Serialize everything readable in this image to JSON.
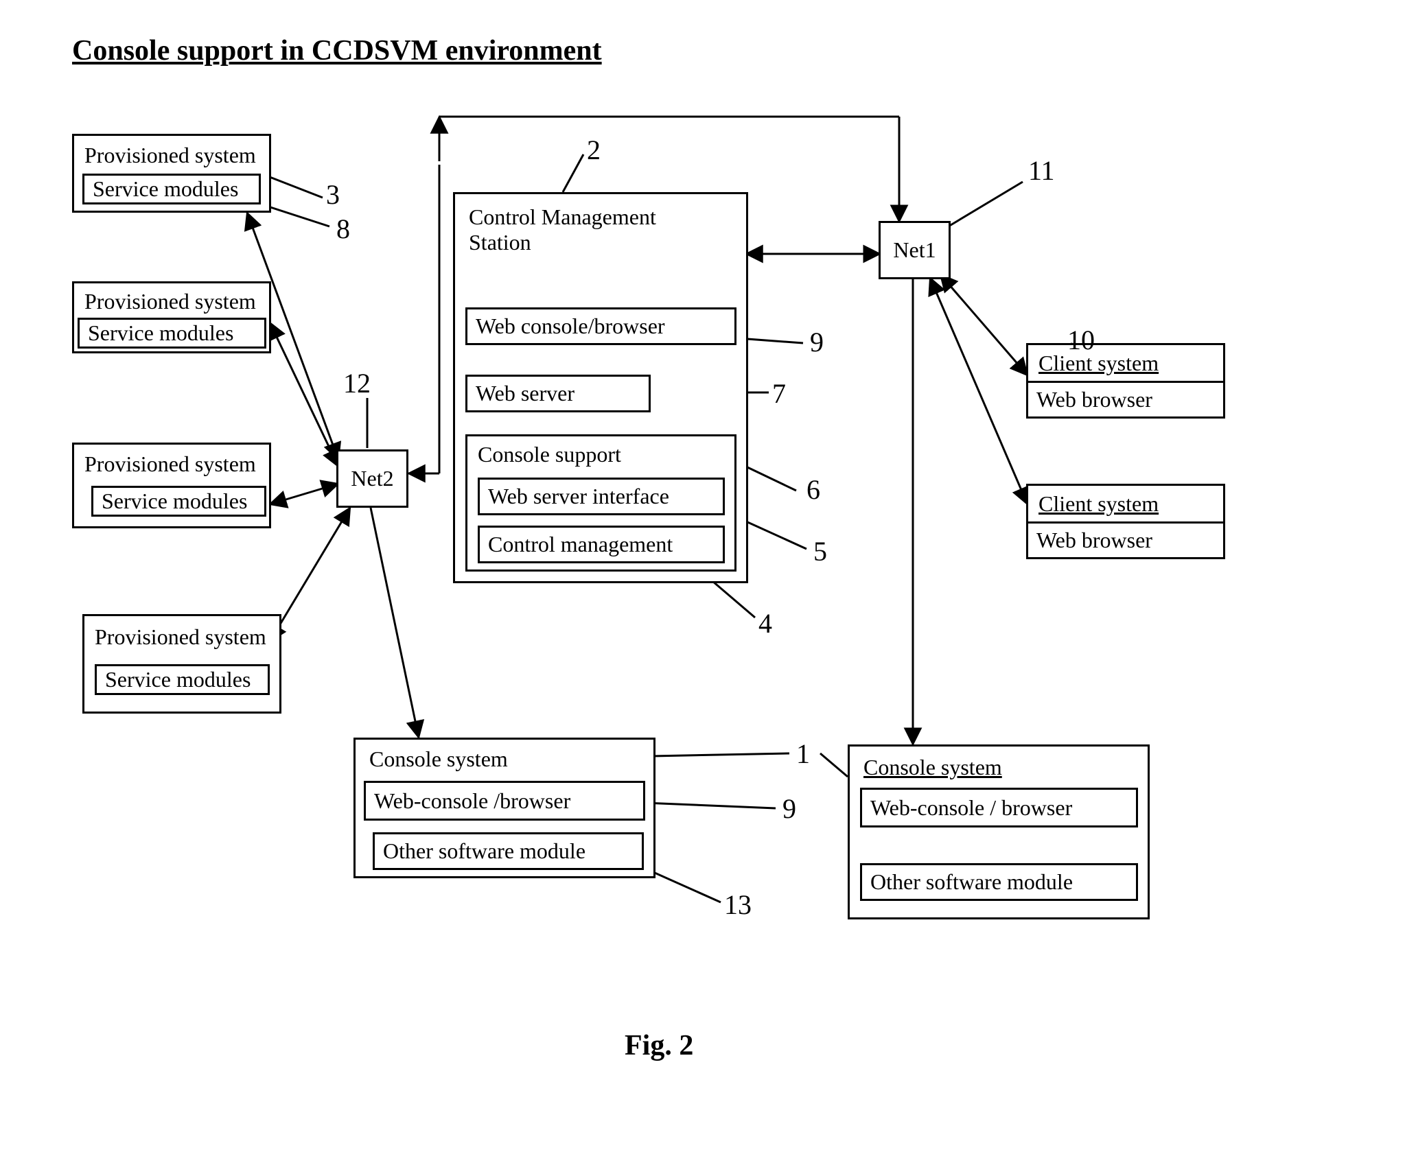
{
  "title": "Console support in CCDSVM environment",
  "figure": "Fig.  2",
  "labels": {
    "provisioned_system": "Provisioned system",
    "service_modules": "Service modules",
    "control_management_station": "Control Management Station",
    "web_console_browser": "Web console/browser",
    "web_server": "Web server",
    "console_support": "Console support",
    "web_server_interface": "Web server interface",
    "control_management": "Control management",
    "net1": "Net1",
    "net2": "Net2",
    "client_system": "Client system",
    "web_browser": "Web browser",
    "console_system": "Console system",
    "web_console_browser2": "Web-console /browser",
    "web_console_browser3": "Web-console / browser",
    "other_software_module": "Other software module"
  },
  "refs": {
    "n1": "1",
    "n2": "2",
    "n3": "3",
    "n4": "4",
    "n5": "5",
    "n6": "6",
    "n7": "7",
    "n8": "8",
    "n9a": "9",
    "n9b": "9",
    "n10": "10",
    "n11": "11",
    "n12": "12",
    "n13": "13"
  }
}
